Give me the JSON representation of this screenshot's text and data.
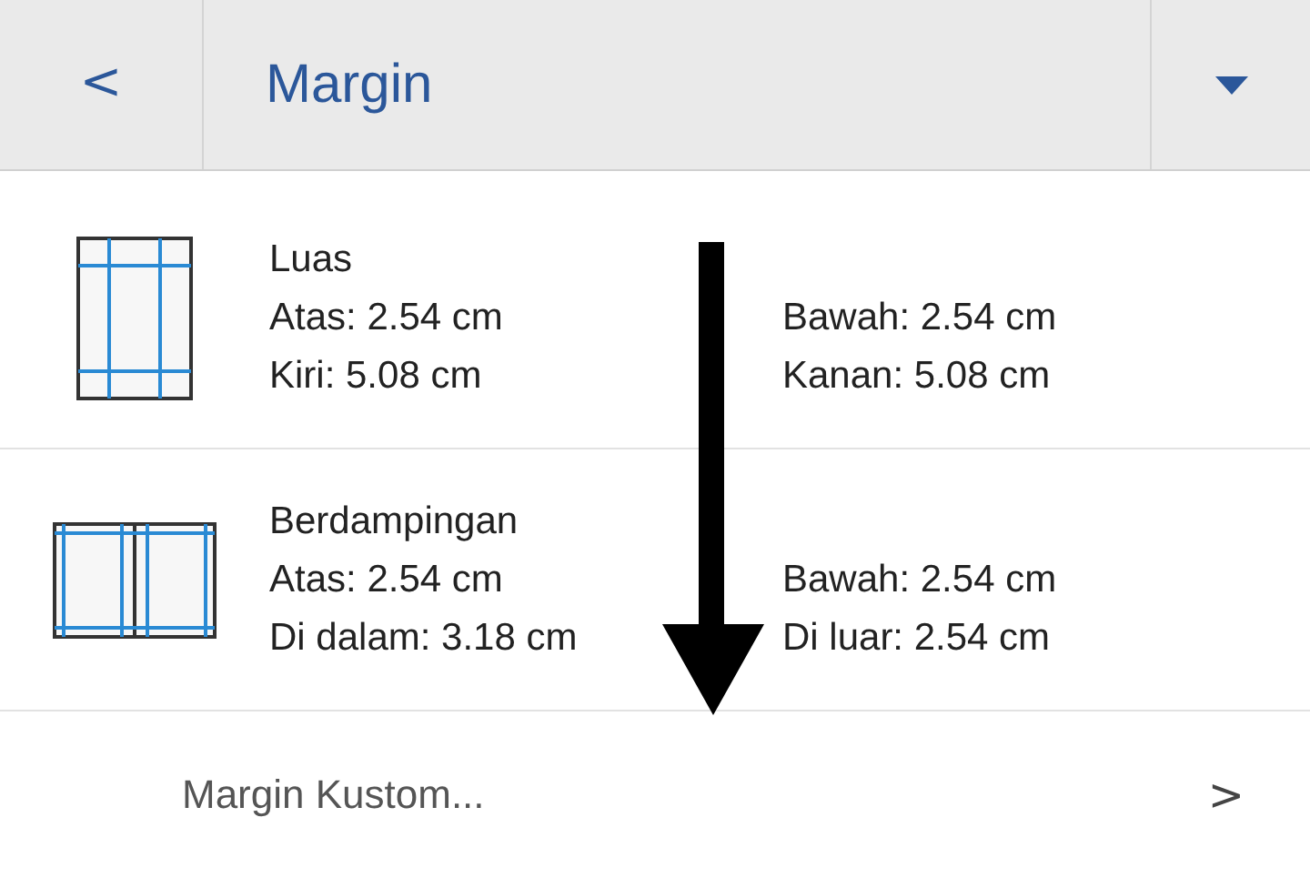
{
  "header": {
    "back": "<",
    "title": "Margin"
  },
  "options": [
    {
      "kind": "wide",
      "name": "Luas",
      "lines": [
        "Atas: 2.54 cm",
        "Bawah: 2.54 cm",
        "Kiri: 5.08 cm",
        "Kanan: 5.08 cm"
      ]
    },
    {
      "kind": "mirrored",
      "name": "Berdampingan",
      "lines": [
        "Atas: 2.54 cm",
        "Bawah: 2.54 cm",
        "Di dalam: 3.18 cm",
        "Di luar: 2.54 cm"
      ]
    }
  ],
  "custom": {
    "label": "Margin Kustom...",
    "chevron": ">"
  }
}
